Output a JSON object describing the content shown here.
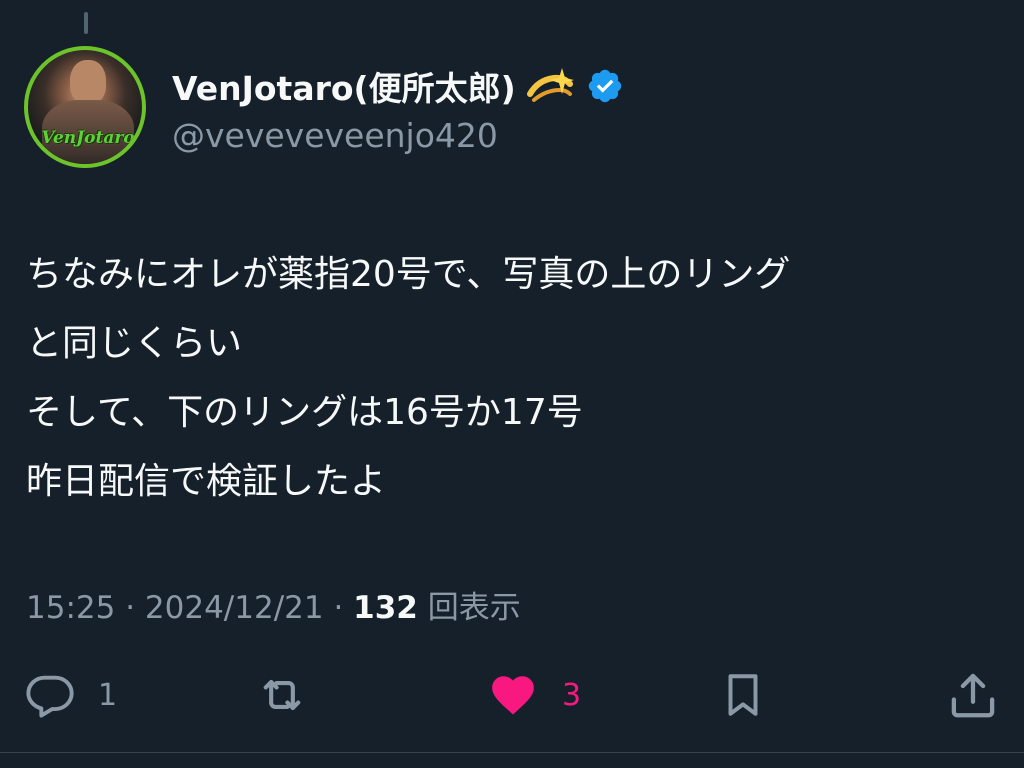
{
  "author": {
    "display_name": "VenJotaro(便所太郎)",
    "handle": "@veveveveenjo420",
    "avatar_text": "VenJotaro",
    "verified": true,
    "name_emoji": "sparkle-icon"
  },
  "tweet": {
    "lines": [
      "ちなみにオレが薬指20号で、写真の上のリング",
      "と同じくらい",
      "そして、下のリングは16号か17号",
      "昨日配信で検証したよ"
    ]
  },
  "meta": {
    "time": "15:25",
    "separator": " · ",
    "date": "2024/12/21",
    "views_count": "132",
    "views_label": "回表示"
  },
  "actions": {
    "reply": {
      "icon": "reply-icon",
      "count": "1"
    },
    "retweet": {
      "icon": "retweet-icon",
      "count": ""
    },
    "like": {
      "icon": "heart-icon",
      "count": "3",
      "liked": true
    },
    "bookmark": {
      "icon": "bookmark-icon",
      "count": ""
    },
    "share": {
      "icon": "share-icon",
      "count": ""
    }
  },
  "colors": {
    "background": "#15202b",
    "text": "#f7f9f9",
    "muted": "#8b98a5",
    "like": "#f91880",
    "verified": "#1d9bf0",
    "avatar_ring": "#6cc42a"
  }
}
